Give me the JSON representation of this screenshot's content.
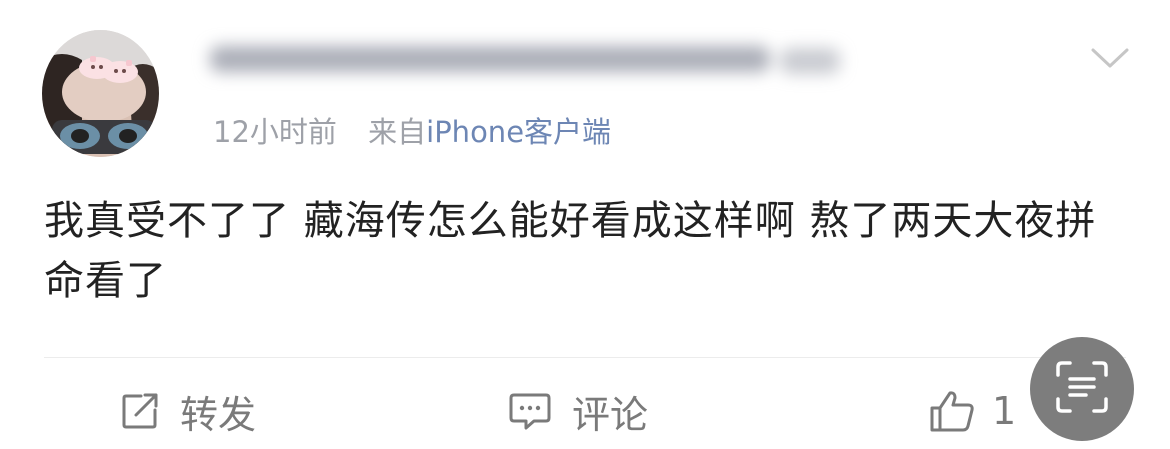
{
  "post": {
    "username": "",
    "time": "12小时前",
    "source_label": "来自",
    "source_device": "iPhone客户端",
    "text": "我真受不了了 藏海传怎么能好看成这样啊 熬了两天大夜拼命看了"
  },
  "actions": {
    "repost_label": "转发",
    "comment_label": "评论",
    "like_count": "1"
  },
  "icons": {
    "avatar": "avatar",
    "menu": "chevron-down-icon",
    "repost": "repost-icon",
    "comment": "comment-icon",
    "like": "thumbs-up-icon",
    "scan": "text-scan-icon"
  },
  "colors": {
    "text": "#222222",
    "meta": "#9ea1a8",
    "source_link": "#6d86b4",
    "action": "#7a7a7a",
    "fab": "#7d7d7d"
  }
}
